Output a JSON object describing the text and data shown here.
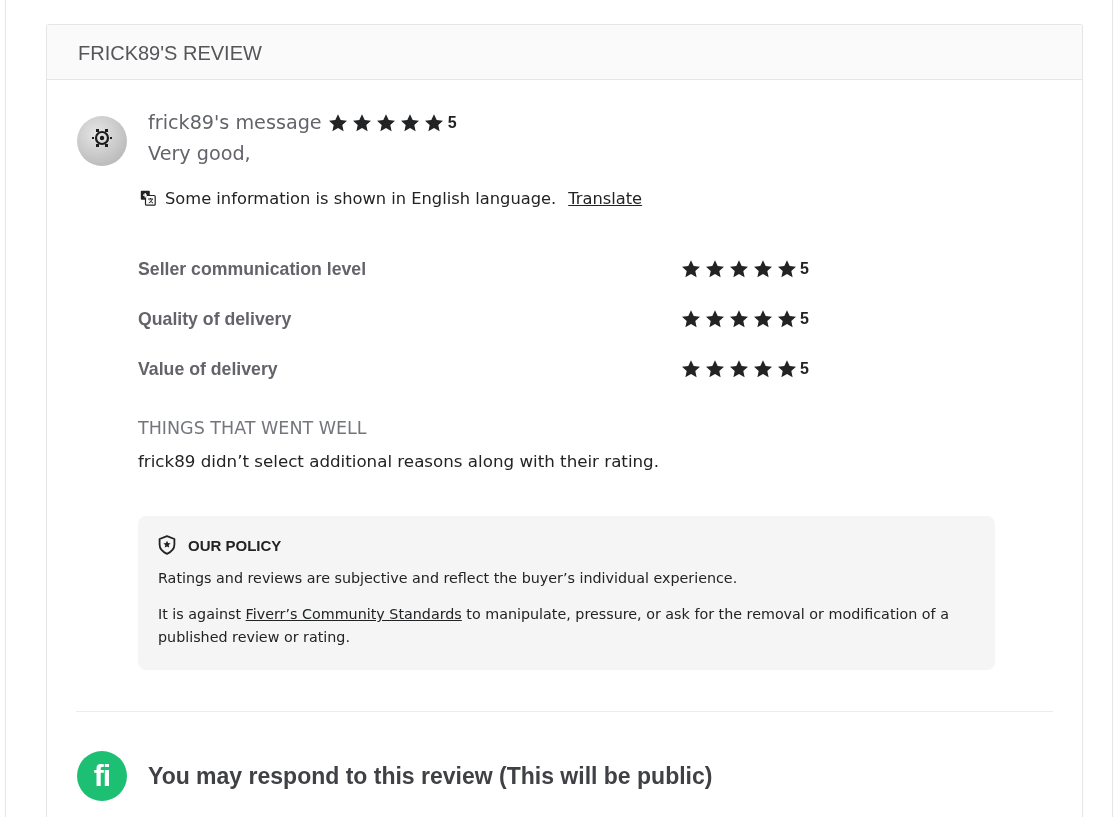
{
  "review_panel": {
    "title": "FRICK89'S REVIEW"
  },
  "message": {
    "author_label": "frick89's message",
    "stars": 5,
    "rating": "5",
    "text": "Very good,"
  },
  "translation_notice": {
    "text": "Some information is shown in English language.",
    "link": "Translate"
  },
  "ratings": [
    {
      "label": "Seller communication level",
      "stars": 5,
      "rating": "5"
    },
    {
      "label": "Quality of delivery",
      "stars": 5,
      "rating": "5"
    },
    {
      "label": "Value of delivery",
      "stars": 5,
      "rating": "5"
    }
  ],
  "things_went_well": {
    "heading": "THINGS THAT WENT WELL",
    "text": "frick89 didn’t select additional reasons along with their rating."
  },
  "policy": {
    "heading": "OUR POLICY",
    "paragraphs": [
      {
        "before": "Ratings and reviews are subjective and reflect the buyer’s individual experience."
      },
      {
        "before": "It is against",
        "link": "Fiverr’s Community Standards",
        "after": "to manipulate, pressure, or ask for the removal or modification of a published review or rating."
      }
    ]
  },
  "response": {
    "logo": "fi",
    "title": "You may respond to this review (This will be public)"
  }
}
